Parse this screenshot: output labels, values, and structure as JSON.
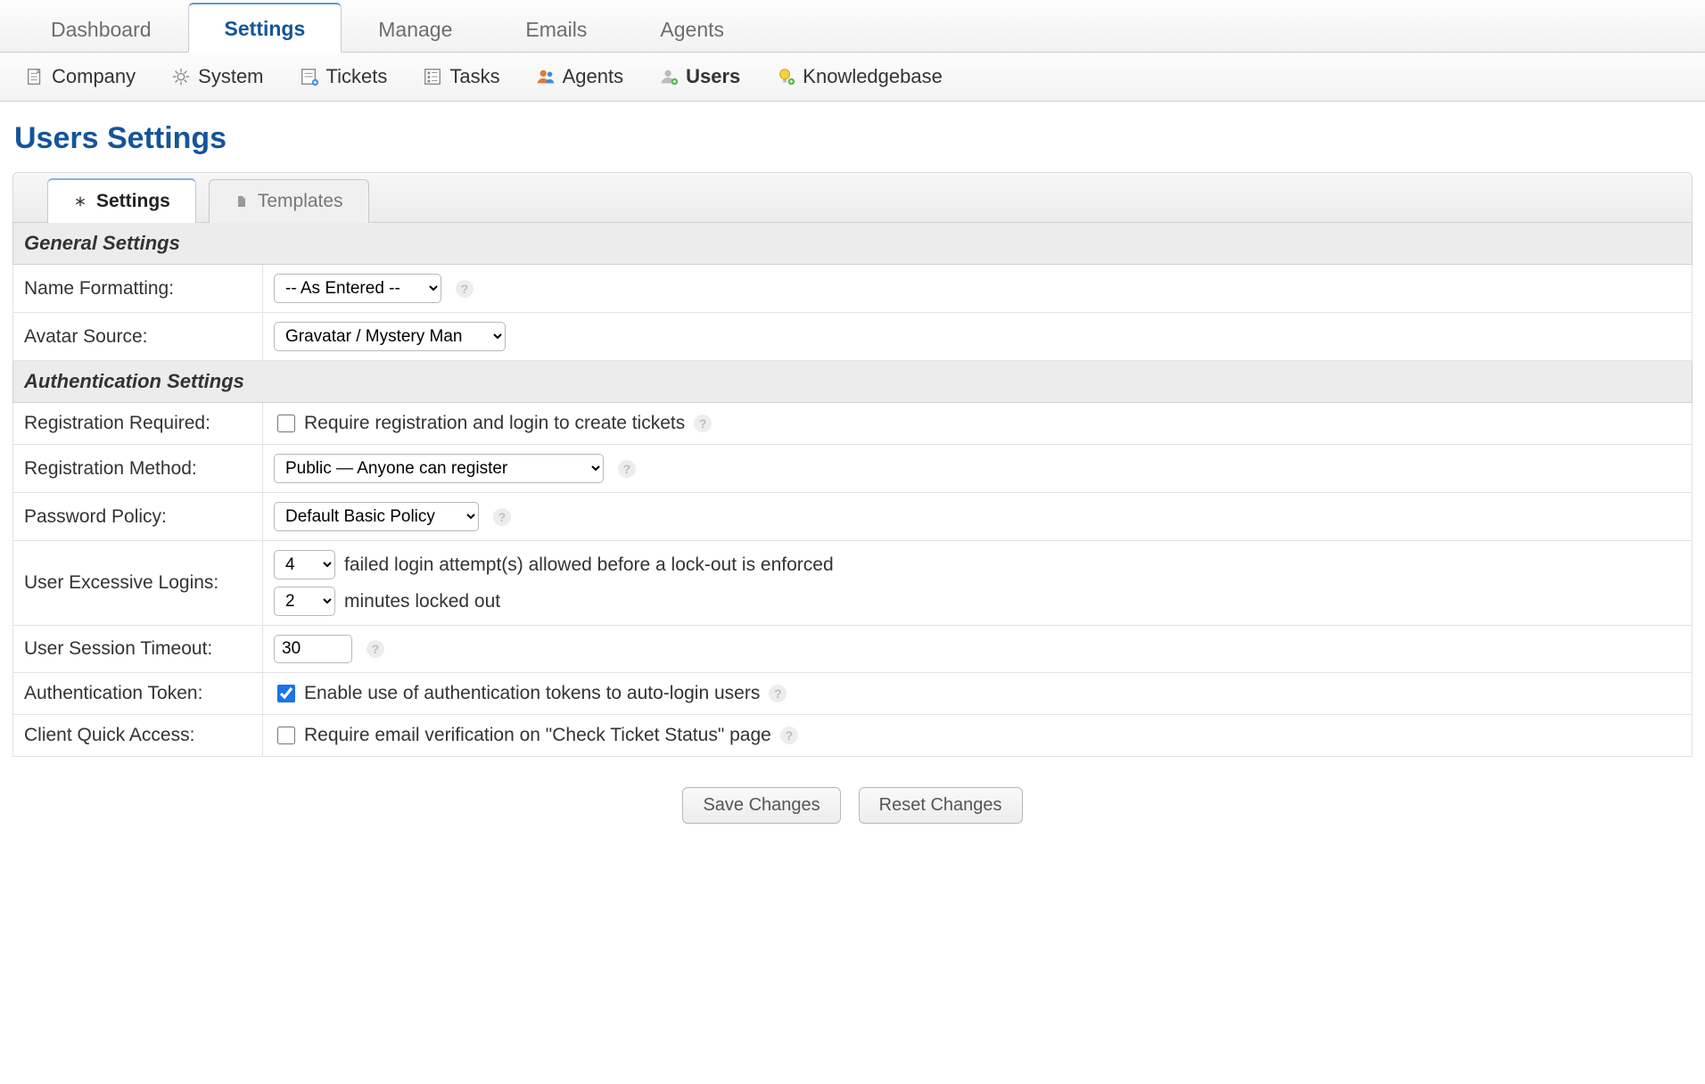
{
  "topnav": {
    "items": [
      {
        "label": "Dashboard"
      },
      {
        "label": "Settings",
        "active": true
      },
      {
        "label": "Manage"
      },
      {
        "label": "Emails"
      },
      {
        "label": "Agents"
      }
    ]
  },
  "subnav": {
    "items": [
      {
        "label": "Company"
      },
      {
        "label": "System"
      },
      {
        "label": "Tickets"
      },
      {
        "label": "Tasks"
      },
      {
        "label": "Agents"
      },
      {
        "label": "Users",
        "active": true
      },
      {
        "label": "Knowledgebase"
      }
    ]
  },
  "page": {
    "title": "Users Settings"
  },
  "innerTabs": {
    "items": [
      {
        "label": "Settings",
        "active": true
      },
      {
        "label": "Templates"
      }
    ]
  },
  "sections": {
    "general": {
      "header": "General Settings",
      "name_formatting": {
        "label": "Name Formatting:",
        "value": "-- As Entered --"
      },
      "avatar_source": {
        "label": "Avatar Source:",
        "value": "Gravatar / Mystery Man"
      }
    },
    "auth": {
      "header": "Authentication Settings",
      "registration_required": {
        "label": "Registration Required:",
        "checked": false,
        "text": "Require registration and login to create tickets"
      },
      "registration_method": {
        "label": "Registration Method:",
        "value": "Public — Anyone can register"
      },
      "password_policy": {
        "label": "Password Policy:",
        "value": "Default Basic Policy"
      },
      "excessive_logins": {
        "label": "User Excessive Logins:",
        "attempts": "4",
        "attempts_text": "failed login attempt(s) allowed before a lock-out is enforced",
        "lockout": "2",
        "lockout_text": "minutes locked out"
      },
      "session_timeout": {
        "label": "User Session Timeout:",
        "value": "30"
      },
      "auth_token": {
        "label": "Authentication Token:",
        "checked": true,
        "text": "Enable use of authentication tokens to auto-login users"
      },
      "quick_access": {
        "label": "Client Quick Access:",
        "checked": false,
        "text": "Require email verification on \"Check Ticket Status\" page"
      }
    }
  },
  "footer": {
    "save": "Save Changes",
    "reset": "Reset Changes"
  }
}
